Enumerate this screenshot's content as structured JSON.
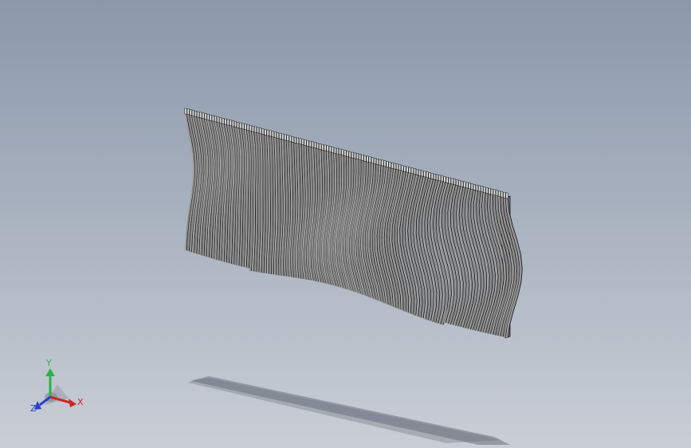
{
  "viewport": {
    "background_top": "#8b98aa",
    "background_bottom": "#c9ced6",
    "model": {
      "kind": "parametric-slat-wave-panel",
      "slat_color": "#8e8e8e",
      "edge_color": "#151515",
      "highlight_color": "#f2f2f2",
      "side_face_color": "#7c7c7c"
    },
    "shadow_color": "#5f6670"
  },
  "triad": {
    "x_label": "X",
    "y_label": "Y",
    "z_label": "Z",
    "x_color": "#d0232a",
    "y_color": "#2bb24c",
    "z_color": "#2a3ec8"
  }
}
